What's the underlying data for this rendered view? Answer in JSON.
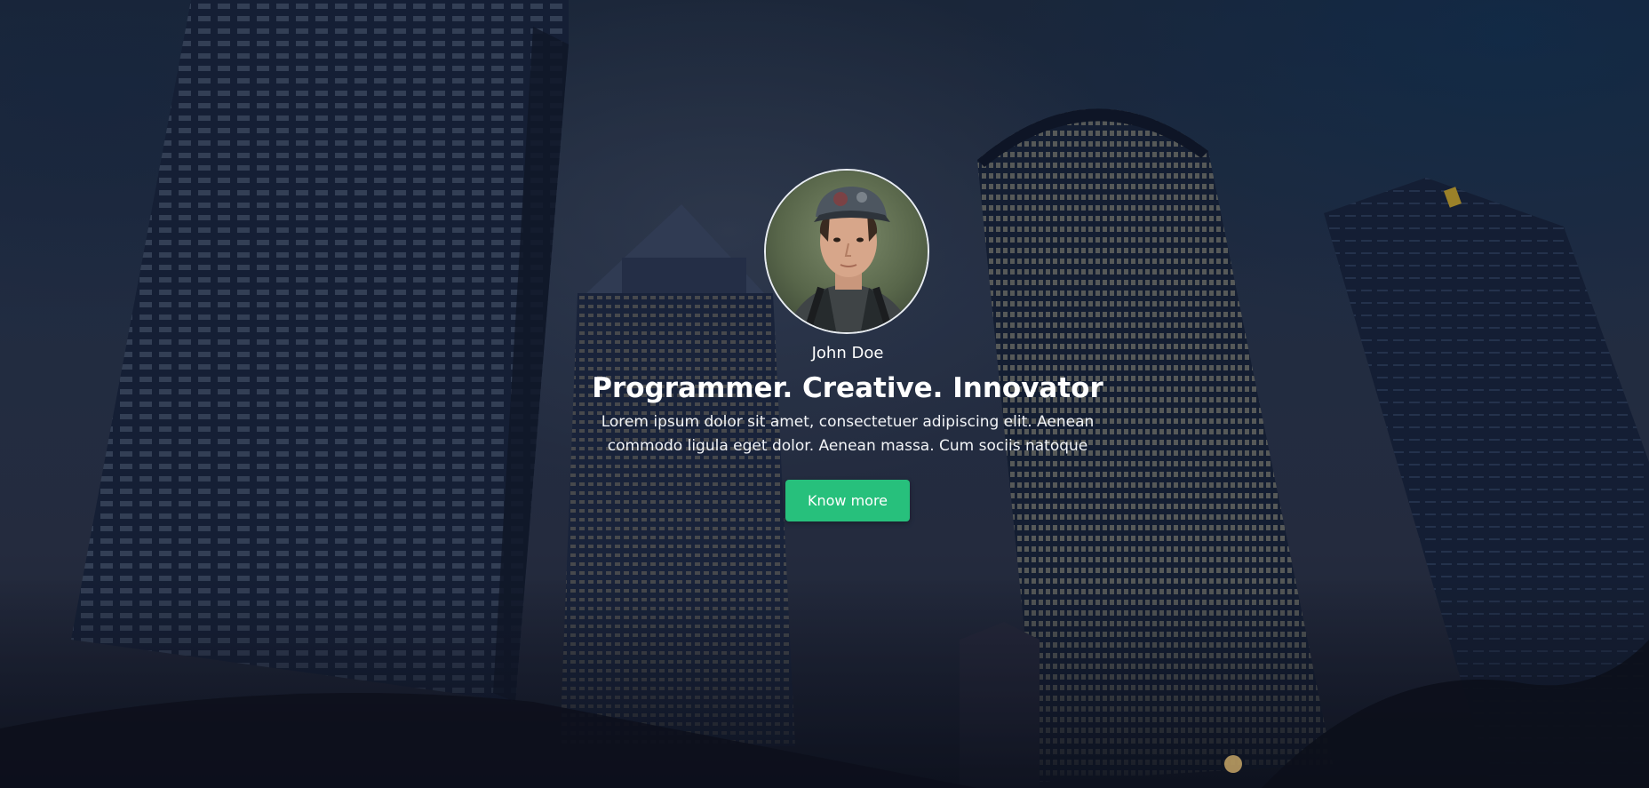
{
  "profile": {
    "name": "John Doe",
    "headline": "Programmer. Creative. Innovator",
    "description": "Lorem ipsum dolor sit amet, consectetuer adipiscing elit. Aenean commodo ligula eget dolor. Aenean massa. Cum sociis natoque",
    "avatar_alt": "avatar-photo"
  },
  "cta": {
    "label": "Know more"
  },
  "colors": {
    "accent": "#27c07c",
    "text": "#ffffff",
    "background": "#26334a"
  }
}
